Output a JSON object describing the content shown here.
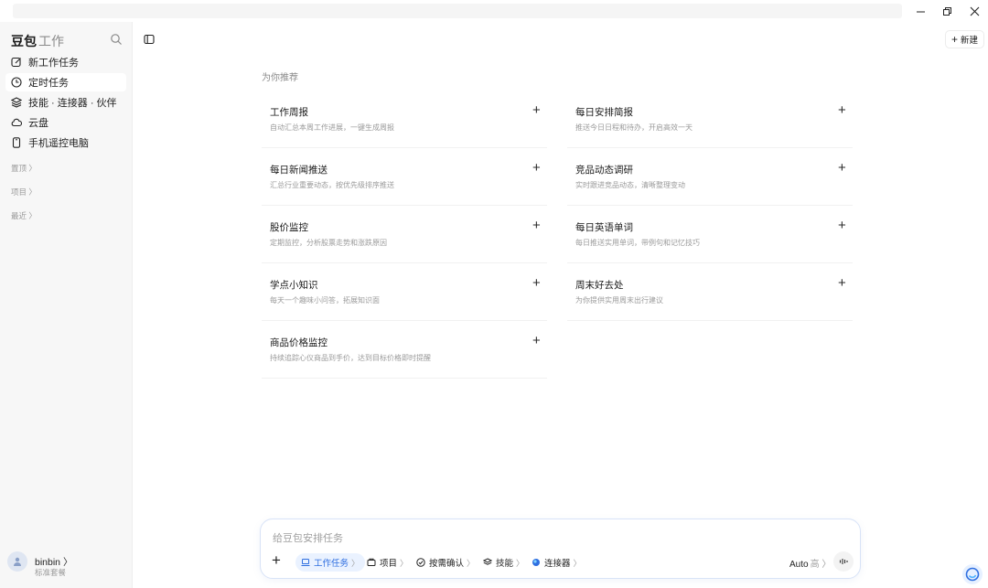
{
  "sidebar": {
    "brand": "豆包",
    "brand_sub": "工作",
    "items": [
      {
        "label": "新工作任务"
      },
      {
        "label": "定时任务"
      },
      {
        "label": "技能 · 连接器 · 伙伴"
      },
      {
        "label": "云盘"
      },
      {
        "label": "手机遥控电脑"
      }
    ],
    "sections": [
      "置顶 〉",
      "项目 〉",
      "最近 〉"
    ],
    "user": {
      "name": "binbin 〉",
      "plan": "标准套餐"
    }
  },
  "header": {
    "new_label": "新建"
  },
  "recommend": {
    "title": "为你推荐",
    "cards": [
      {
        "title": "工作周报",
        "desc": "自动汇总本周工作进展，一键生成周报"
      },
      {
        "title": "每日安排简报",
        "desc": "推送今日日程和待办，开启高效一天"
      },
      {
        "title": "每日新闻推送",
        "desc": "汇总行业重要动态，按优先级排序推送"
      },
      {
        "title": "竞品动态调研",
        "desc": "实时跟进竞品动态，清晰整理变动"
      },
      {
        "title": "股价监控",
        "desc": "定期监控，分析股票走势和涨跌原因"
      },
      {
        "title": "每日英语单词",
        "desc": "每日推送实用单词，带例句和记忆技巧"
      },
      {
        "title": "学点小知识",
        "desc": "每天一个趣味小问答，拓展知识面"
      },
      {
        "title": "周末好去处",
        "desc": "为你提供实用周末出行建议"
      },
      {
        "title": "商品价格监控",
        "desc": "持续追踪心仪商品到手价，达到目标价格即时提醒"
      }
    ]
  },
  "composer": {
    "placeholder": "给豆包安排任务",
    "chips": [
      {
        "label": "工作任务",
        "arrow": "〉"
      },
      {
        "label": "项目",
        "arrow": "〉"
      },
      {
        "label": "按需确认",
        "arrow": "〉"
      },
      {
        "label": "技能",
        "arrow": "〉"
      },
      {
        "label": "连接器",
        "arrow": "〉"
      }
    ],
    "mode": "Auto",
    "mode_level": "高 〉"
  },
  "colors": {
    "accent": "#2f6fe0",
    "chip_bg": "#eaf2ff"
  }
}
